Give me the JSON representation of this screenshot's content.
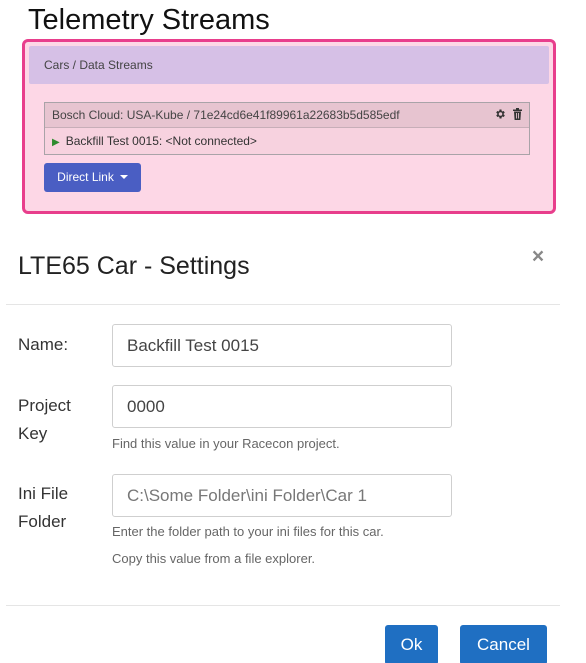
{
  "page": {
    "title": "Telemetry Streams"
  },
  "panel": {
    "breadcrumb": "Cars / Data Streams",
    "stream": {
      "title": "Bosch Cloud: USA-Kube / 71e24cd6e41f89961a22683b5d585edf",
      "row_label": "Backfill Test 0015: <Not connected>",
      "status_icon": "play-icon",
      "settings_icon": "gear-icon",
      "delete_icon": "trash-icon"
    },
    "direct_link_label": "Direct Link"
  },
  "modal": {
    "title": "LTE65 Car - Settings",
    "close_label": "×",
    "fields": {
      "name": {
        "label": "Name:",
        "value": "Backfill Test 0015"
      },
      "project_key": {
        "label_line1": "Project",
        "label_line2": "Key",
        "value": "0000",
        "help": "Find this value in your Racecon project."
      },
      "ini_folder": {
        "label_line1": "Ini File",
        "label_line2": "Folder",
        "placeholder": "C:\\Some Folder\\ini Folder\\Car 1",
        "help1": "Enter the folder path to your ini files for this car.",
        "help2": "Copy this value from a file explorer."
      }
    },
    "ok_label": "Ok",
    "cancel_label": "Cancel"
  },
  "colors": {
    "panel_border": "#e83e8c",
    "panel_bg": "#fdd7e6",
    "panel_header_bg": "#d6c0e6",
    "direct_link_bg": "#4a5ec3",
    "primary_button": "#1f6fc2"
  }
}
